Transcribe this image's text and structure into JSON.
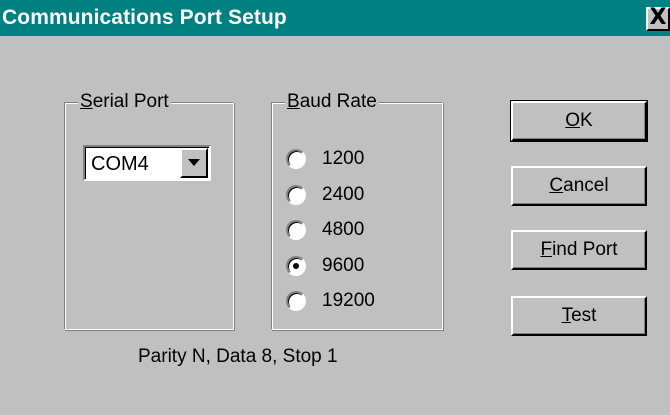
{
  "window": {
    "title": "Communications Port Setup",
    "close_symbol": "X"
  },
  "serial_port": {
    "label_first": "S",
    "label_rest": "erial Port",
    "selected": "COM4"
  },
  "baud_rate": {
    "label_first": "B",
    "label_rest": "aud Rate",
    "options": [
      "1200",
      "2400",
      "4800",
      "9600",
      "19200"
    ],
    "selected": "9600"
  },
  "settings_text": "Parity N, Data 8, Stop 1",
  "buttons": {
    "ok": {
      "first": "O",
      "rest": "K"
    },
    "cancel": {
      "first": "C",
      "rest": "ancel"
    },
    "find_port": {
      "first": "F",
      "rest": "ind Port"
    },
    "test": {
      "first": "T",
      "rest": "est"
    }
  },
  "colors": {
    "titlebar": "#008080",
    "face": "#c0c0c0"
  }
}
